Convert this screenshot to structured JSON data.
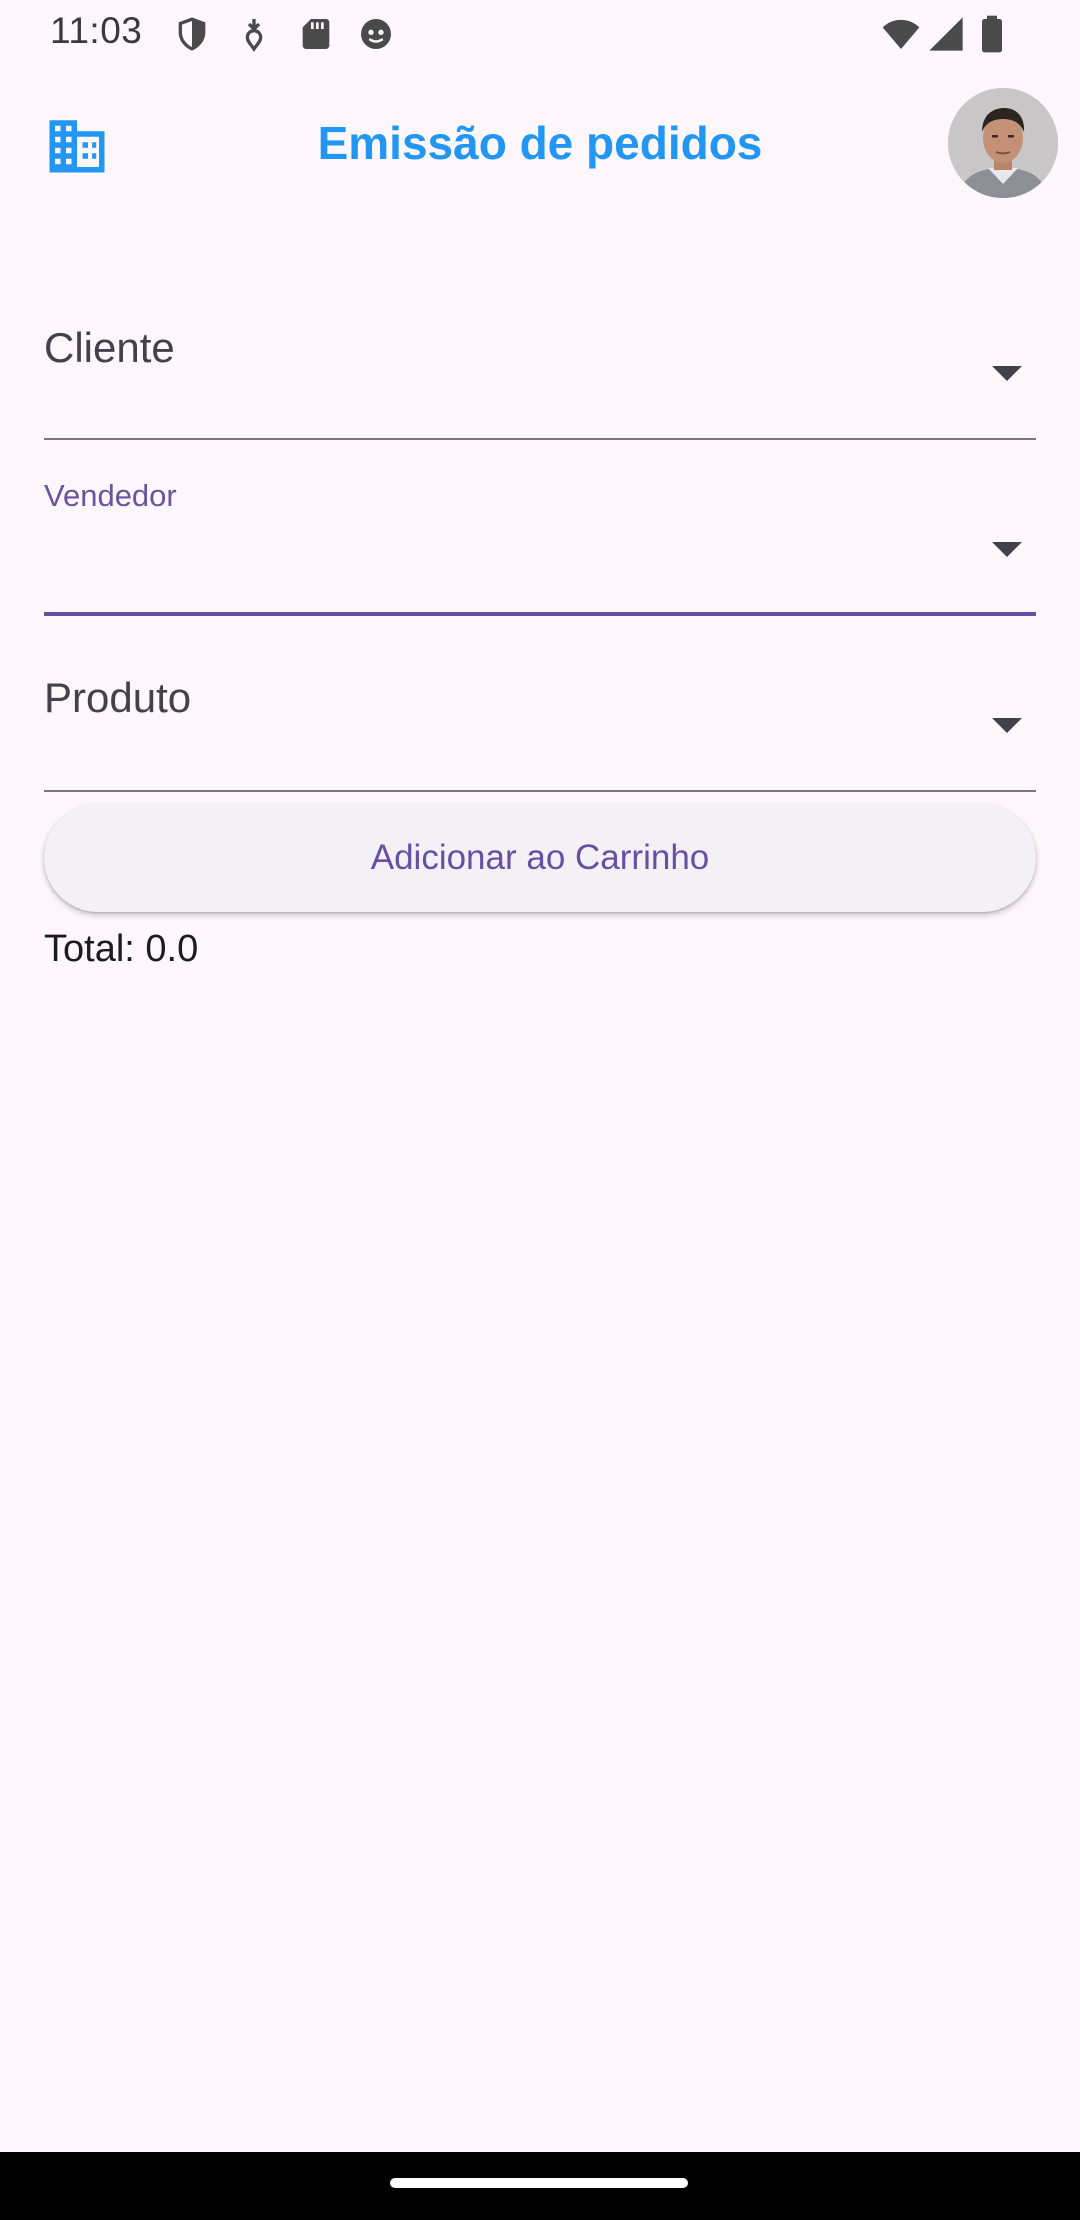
{
  "status_bar": {
    "time": "11:03",
    "left_icons": [
      "shield-icon",
      "usb-debug-icon",
      "sd-card-icon",
      "android-face-icon"
    ],
    "right_icons": [
      "wifi-icon",
      "signal-icon",
      "battery-icon"
    ]
  },
  "app_bar": {
    "title": "Emissão de pedidos",
    "title_color": "#2196f3",
    "leading_icon": "building-icon",
    "avatar": "user-avatar"
  },
  "form": {
    "cliente": {
      "label": "Cliente",
      "value": ""
    },
    "vendedor": {
      "label": "Vendedor",
      "value": "",
      "focused": true
    },
    "produto": {
      "label": "Produto",
      "value": ""
    }
  },
  "actions": {
    "add_to_cart_label": "Adicionar ao Carrinho"
  },
  "summary": {
    "total_text": "Total: 0.0"
  },
  "colors": {
    "background": "#fdf7fb",
    "accent": "#6750a4",
    "title_blue": "#2196f3"
  }
}
